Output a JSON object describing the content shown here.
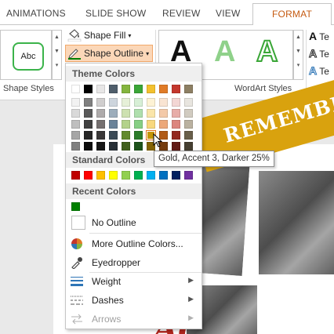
{
  "tabs": [
    "ANIMATIONS",
    "SLIDE SHOW",
    "REVIEW",
    "VIEW",
    "FORMAT"
  ],
  "ribbon": {
    "shape_styles_label": "Shape Styles",
    "wordart_styles_label": "WordArt Styles",
    "abc_thumb": "Abc",
    "shape_fill": "Shape Fill",
    "shape_outline": "Shape Outline",
    "wordart_letter": "A",
    "text_partial": "Te",
    "colors": {
      "accent_green": "#3bb34a",
      "highlight": "#fbd7b8",
      "format_tab": "#c55a11"
    }
  },
  "menu": {
    "theme_colors_header": "Theme Colors",
    "standard_colors_header": "Standard Colors",
    "recent_colors_header": "Recent Colors",
    "theme_columns": [
      [
        "#ffffff",
        "#f2f2f2",
        "#d9d9d9",
        "#bfbfbf",
        "#a6a6a6",
        "#808080"
      ],
      [
        "#000000",
        "#7f7f7f",
        "#595959",
        "#404040",
        "#262626",
        "#0d0d0d"
      ],
      [
        "#e7e6e6",
        "#d0cece",
        "#aeabab",
        "#757070",
        "#3a3838",
        "#161616"
      ],
      [
        "#4f5e6b",
        "#cdd5dd",
        "#9cadbb",
        "#6a8399",
        "#3b4a56",
        "#272f36"
      ],
      [
        "#84b53e",
        "#e6f0d8",
        "#cde1b1",
        "#b3d28a",
        "#628a2c",
        "#41601d"
      ],
      [
        "#3aa637",
        "#d7efd6",
        "#afdfad",
        "#86cf84",
        "#2b7c29",
        "#1d531b"
      ],
      [
        "#f3c12e",
        "#fdf2d4",
        "#fae5a9",
        "#f8d87e",
        "#c49505",
        "#836304"
      ],
      [
        "#e07b27",
        "#f9e4d2",
        "#f3c9a8",
        "#eca87a",
        "#b05a15",
        "#753c0e"
      ],
      [
        "#c4372d",
        "#f3d6d4",
        "#e7ada8",
        "#dc857e",
        "#932920",
        "#621b15"
      ],
      [
        "#8d7f63",
        "#e8e5df",
        "#d1cbc0",
        "#bab1a0",
        "#695f4a",
        "#463f31"
      ]
    ],
    "highlighted_swatch": {
      "column": 6,
      "row": 4
    },
    "standard_colors": [
      "#c00000",
      "#ff0000",
      "#ffc000",
      "#ffff00",
      "#92d050",
      "#00b050",
      "#00b0f0",
      "#0070c0",
      "#002060",
      "#7030a0"
    ],
    "recent_colors": [
      "#008000"
    ],
    "no_outline": "No Outline",
    "more_outline_colors": "More Outline Colors...",
    "eyedropper": "Eyedropper",
    "weight": "Weight",
    "dashes": "Dashes",
    "arrows": "Arrows"
  },
  "tooltip": "Gold, Accent 3, Darker 25%",
  "slide": {
    "banner_text": "REMEMBER",
    "title_partial": "Ac"
  }
}
